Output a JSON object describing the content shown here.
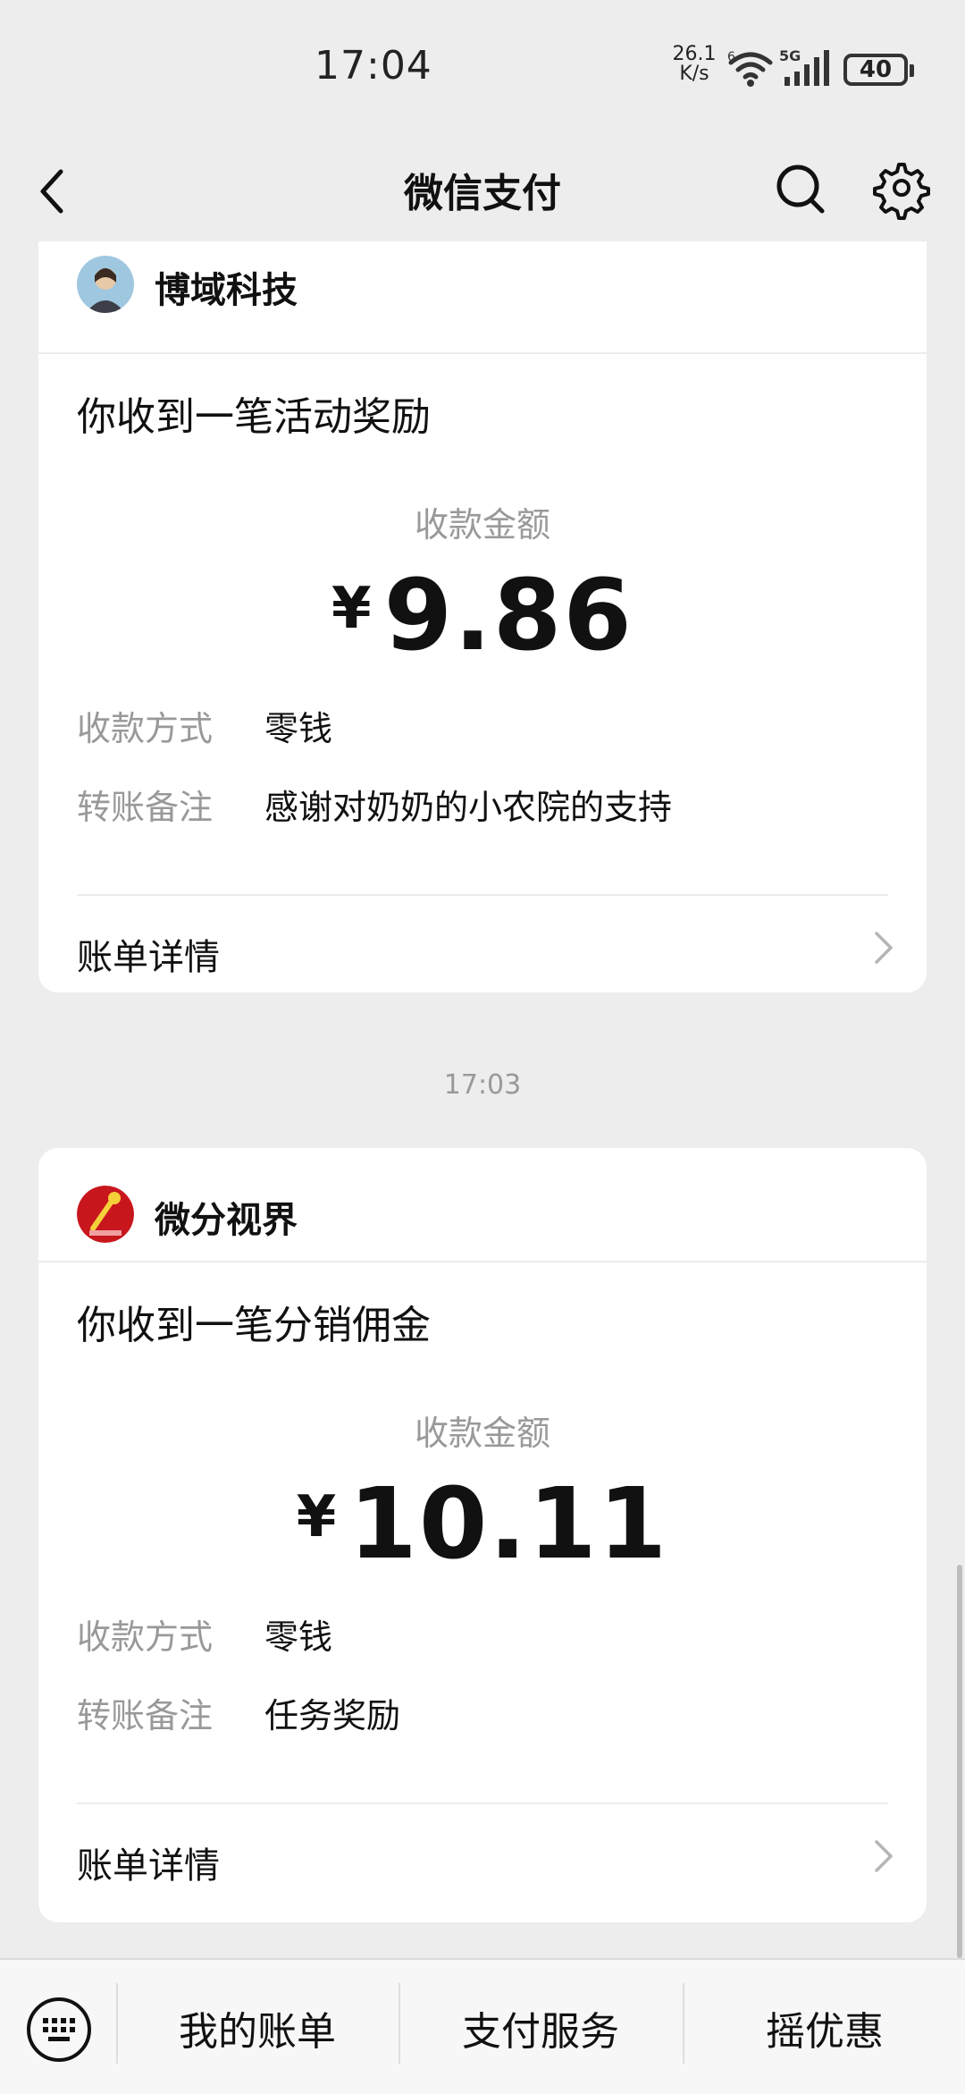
{
  "status_bar": {
    "time": "17:04",
    "net_speed_value": "26.1",
    "net_speed_unit": "K/s",
    "wifi_label": "6",
    "signal_label": "5G",
    "battery": "40"
  },
  "nav": {
    "title": "微信支付",
    "back_icon": "chevron-left-icon",
    "search_icon": "search-icon",
    "settings_icon": "gear-icon"
  },
  "messages": [
    {
      "merchant": "博域科技",
      "title": "你收到一笔活动奖励",
      "amount_label": "收款金额",
      "currency": "¥",
      "amount": "9.86",
      "method_label": "收款方式",
      "method": "零钱",
      "note_label": "转账备注",
      "note": "感谢对奶奶的小农院的支持",
      "details_label": "账单详情"
    },
    {
      "merchant": "微分视界",
      "title": "你收到一笔分销佣金",
      "amount_label": "收款金额",
      "currency": "¥",
      "amount": "10.11",
      "method_label": "收款方式",
      "method": "零钱",
      "note_label": "转账备注",
      "note": "任务奖励",
      "details_label": "账单详情"
    }
  ],
  "timestamp": "17:03",
  "bottom_menu": {
    "keyboard_icon": "keyboard-icon",
    "items": [
      "我的账单",
      "支付服务",
      "摇优惠"
    ]
  },
  "colors": {
    "background": "#ededed",
    "card": "#ffffff",
    "muted_text": "#999999",
    "primary_text": "#111111"
  }
}
